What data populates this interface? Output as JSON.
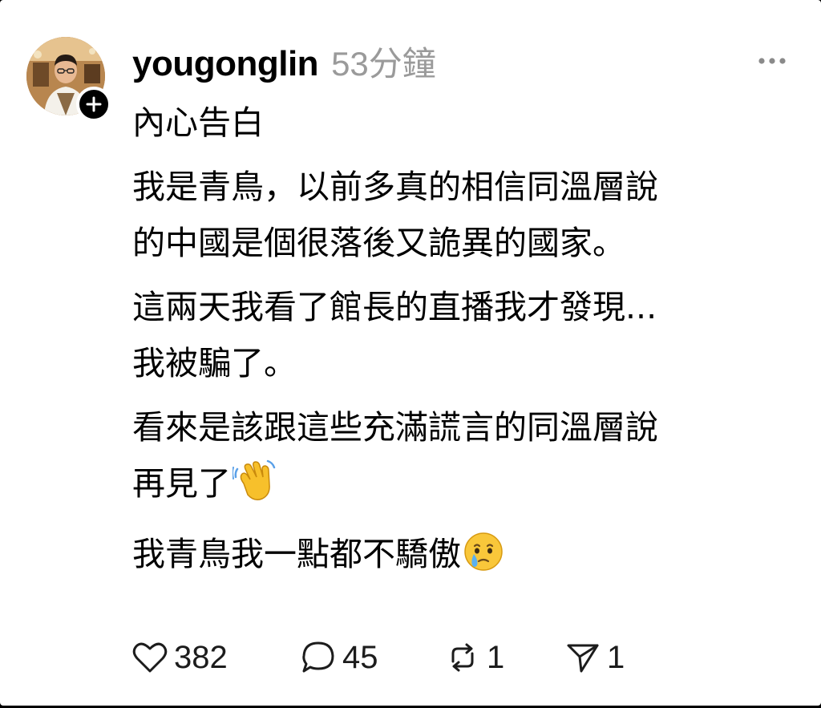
{
  "post": {
    "username": "yougonglin",
    "timestamp": "53分鐘",
    "title": "內心告白",
    "paragraphs": [
      "我是青鳥，以前多真的相信同溫層說\n的中國是個很落後又詭異的國家。",
      "這兩天我看了館長的直播我才發現...\n我被騙了。",
      "看來是該跟這些充滿謊言的同溫層說\n再見了",
      "我青鳥我一點都不驕傲"
    ],
    "emojis": [
      "waving-hand",
      "face-holding-back-tears"
    ]
  },
  "stats": {
    "likes": "382",
    "replies": "45",
    "reposts": "1",
    "shares": "1"
  },
  "colors": {
    "background": "#ffffff",
    "text": "#000000",
    "muted": "#9a9a9a",
    "frame": "#000000"
  },
  "icons": {
    "avatar": "profile-photo",
    "follow": "plus-icon",
    "more": "more-horizontal-icon",
    "like": "heart-icon",
    "reply": "comment-bubble-icon",
    "repost": "repost-icon",
    "share": "send-icon"
  }
}
